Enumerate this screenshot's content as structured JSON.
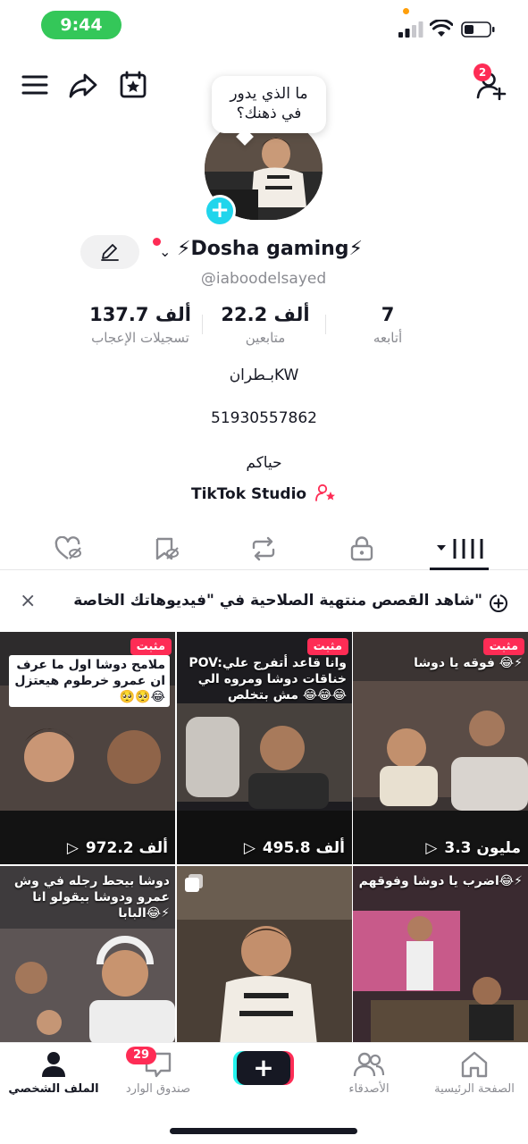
{
  "status_bar": {
    "time": "9:44"
  },
  "header": {
    "friend_requests_count": "2"
  },
  "profile": {
    "bubble_text_line1": "ما الذي يدور",
    "bubble_text_line2": "في ذهنك؟",
    "display_name": "⚡Dosha gaming⚡",
    "username": "@iaboodelsayed",
    "stats": [
      {
        "value": "7",
        "label": "أتابعه"
      },
      {
        "value": "22.2 ألف",
        "label": "متابعين"
      },
      {
        "value": "137.7 ألف",
        "label": "تسجيلات الإعجاب"
      }
    ],
    "bio_lines": [
      "بـطرانKW",
      "51930557862",
      "حياكم"
    ],
    "studio_link": "TikTok Studio"
  },
  "tabs": [
    {
      "name": "videos",
      "icon": "grid-icon",
      "active": true
    },
    {
      "name": "private",
      "icon": "lock-icon"
    },
    {
      "name": "reposts",
      "icon": "repost-icon"
    },
    {
      "name": "favorites",
      "icon": "bookmark-hidden-icon"
    },
    {
      "name": "liked",
      "icon": "heart-hidden-icon"
    }
  ],
  "banner": {
    "text": "شاهد القصص منتهية الصلاحية في \"فيديوهاتك الخاصة\""
  },
  "videos": [
    {
      "caption": "فوقه يا دوشا 😂⚡",
      "pinned_label": "مثبت",
      "views": "3.3 مليون",
      "style": "dark"
    },
    {
      "caption": "POV:وانا قاعد أتفرج علي خناقات دوشا ومروه الي مش بتخلص 😂😂😂",
      "pinned_label": "مثبت",
      "views": "495.8 ألف",
      "style": "dark"
    },
    {
      "caption": "ملامح دوشا اول ما عرف ان عمرو خرطوم هيعتزل 🥺🥺😂",
      "pinned_label": "مثبت",
      "views": "972.2 ألف",
      "style": "white"
    },
    {
      "caption": "اضرب يا دوشا وفوقهم😂⚡",
      "pinned_label": "",
      "views": "",
      "style": "dark"
    },
    {
      "caption": "",
      "pinned_label": "",
      "views": "",
      "style": "dark"
    },
    {
      "caption": "دوشا بيحط رجله في وش عمرو ودوشا بيقولو انا البابا😂⚡",
      "pinned_label": "",
      "views": "",
      "style": "dark"
    }
  ],
  "bottom_nav": {
    "items": [
      {
        "label": "الصفحة الرئيسية",
        "icon": "home-icon"
      },
      {
        "label": "الأصدقاء",
        "icon": "friends-icon"
      },
      {
        "label": "",
        "icon": "create-plus-icon"
      },
      {
        "label": "صندوق الوارد",
        "icon": "inbox-icon"
      },
      {
        "label": "الملف الشخصي",
        "icon": "profile-icon"
      }
    ],
    "inbox_badge": "29"
  },
  "colors": {
    "accent": "#fe2c55",
    "cyan": "#25f4ee",
    "status_green": "#34c759"
  }
}
